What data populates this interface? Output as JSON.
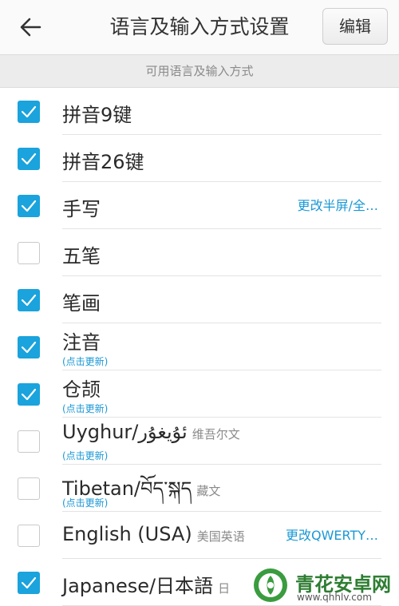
{
  "header": {
    "back_icon": "arrow-left-icon",
    "title": "语言及输入方式设置",
    "edit_label": "编辑"
  },
  "section": {
    "title": "可用语言及输入方式"
  },
  "accent_color": "#1aa3dc",
  "items": [
    {
      "name": "拼音9键",
      "sub": "",
      "update": "",
      "action": "",
      "checked": true
    },
    {
      "name": "拼音26键",
      "sub": "",
      "update": "",
      "action": "",
      "checked": true
    },
    {
      "name": "手写",
      "sub": "",
      "update": "",
      "action": "更改半屏/全…",
      "checked": true
    },
    {
      "name": "五笔",
      "sub": "",
      "update": "",
      "action": "",
      "checked": false
    },
    {
      "name": "笔画",
      "sub": "",
      "update": "",
      "action": "",
      "checked": true
    },
    {
      "name": "注音",
      "sub": "",
      "update": "(点击更新)",
      "action": "",
      "checked": true
    },
    {
      "name": "仓颉",
      "sub": "",
      "update": "(点击更新)",
      "action": "",
      "checked": true
    },
    {
      "name": "Uyghur/ئۇيغۇر",
      "sub": "维吾尔文",
      "update": "(点击更新)",
      "action": "",
      "checked": false
    },
    {
      "name": "Tibetan/བོད་སྐད",
      "sub": "藏文",
      "update": "(点击更新)",
      "action": "",
      "checked": false
    },
    {
      "name": "English (USA)",
      "sub": "美国英语",
      "update": "",
      "action": "更改QWERTY…",
      "checked": false
    },
    {
      "name": "Japanese/日本語",
      "sub": "日",
      "update": "",
      "action": "",
      "checked": true
    }
  ],
  "watermark": {
    "name": "青花安卓网",
    "url": "www.qhhlv.com",
    "logo_icon": "qinghua-logo-icon"
  }
}
